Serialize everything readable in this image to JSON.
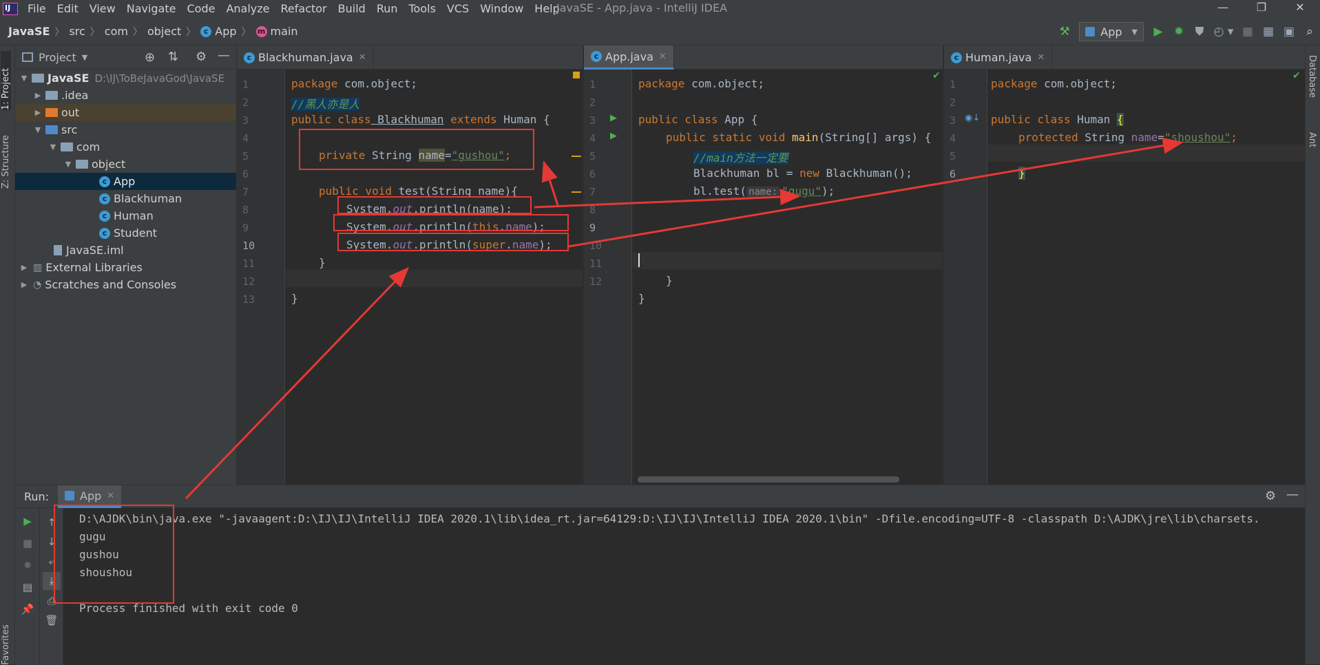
{
  "menubar": {
    "items": [
      "File",
      "Edit",
      "View",
      "Navigate",
      "Code",
      "Analyze",
      "Refactor",
      "Build",
      "Run",
      "Tools",
      "VCS",
      "Window",
      "Help"
    ],
    "title": "JavaSE - App.java - IntelliJ IDEA"
  },
  "navbar": {
    "crumbs": [
      "JavaSE",
      "src",
      "com",
      "object",
      "App",
      "main"
    ],
    "run_config": "App"
  },
  "left_strip": {
    "project_tab": "1: Project",
    "structure_tab": "Z: Structure",
    "favorites_tab": "Favorites"
  },
  "right_strip": {
    "database_tab": "Database",
    "ant_tab": "Ant"
  },
  "project": {
    "header": "Project",
    "tree": [
      {
        "label": "JavaSE",
        "path": "D:\\IJ\\ToBeJavaGod\\JavaSE"
      },
      {
        "label": ".idea"
      },
      {
        "label": "out"
      },
      {
        "label": "src"
      },
      {
        "label": "com"
      },
      {
        "label": "object"
      },
      {
        "label": "App"
      },
      {
        "label": "Blackhuman"
      },
      {
        "label": "Human"
      },
      {
        "label": "Student"
      },
      {
        "label": "JavaSE.iml"
      },
      {
        "label": "External Libraries"
      },
      {
        "label": "Scratches and Consoles"
      }
    ]
  },
  "editors": {
    "blackhuman": {
      "tab": "Blackhuman.java",
      "lines": [
        "1",
        "2",
        "3",
        "4",
        "5",
        "6",
        "7",
        "8",
        "9",
        "10",
        "11",
        "12",
        "13"
      ],
      "code": {
        "l1_kw": "package",
        "l1_rest": " com.object;",
        "l2": "//黑人亦是人",
        "l3_kw1": "public class",
        "l3_cls": " Blackhuman",
        "l3_kw2": " extends",
        "l3_rest": " Human {",
        "l5_kw": "private",
        "l5_type": " String ",
        "l5_name": "name",
        "l5_eq": "=",
        "l5_str": "\"gushou\"",
        "l5_end": ";",
        "l7_kw": "public void",
        "l7_fn": " test",
        "l7_rest": "(String name){",
        "l8_a": "System.",
        "l8_out": "out",
        "l8_b": ".println(name);",
        "l9_a": "System.",
        "l9_out": "out",
        "l9_b": ".println(",
        "l9_kw": "this",
        "l9_c": ".",
        "l9_fld": "name",
        "l9_d": ");",
        "l10_a": "System.",
        "l10_out": "out",
        "l10_b": ".println(",
        "l10_kw": "super",
        "l10_c": ".",
        "l10_fld": "name",
        "l10_d": ");",
        "l11": "}",
        "l13": "}"
      }
    },
    "app": {
      "tab": "App.java",
      "lines": [
        "1",
        "2",
        "3",
        "4",
        "5",
        "6",
        "7",
        "8",
        "9",
        "10",
        "11",
        "12"
      ],
      "code": {
        "l1_kw": "package",
        "l1_rest": " com.object;",
        "l3_kw": "public class",
        "l3_rest": " App {",
        "l4_kw": "public static void",
        "l4_fn": " main",
        "l4_rest": "(String[] args) {",
        "l5": "//main方法一定要",
        "l6_a": "Blackhuman bl = ",
        "l6_kw": "new",
        "l6_b": " Blackhuman();",
        "l7_a": "bl.test(",
        "l7_hint": "name:",
        "l7_str": "\"gugu\"",
        "l7_b": ");",
        "l10": "}",
        "l11": "}"
      }
    },
    "human": {
      "tab": "Human.java",
      "lines": [
        "1",
        "2",
        "3",
        "4",
        "5",
        "6"
      ],
      "code": {
        "l1_kw": "package",
        "l1_rest": " com.object;",
        "l3_kw": "public class",
        "l3_rest": " Human ",
        "l3_brace": "{",
        "l4_kw": "protected",
        "l4_type": " String ",
        "l4_fld": "name",
        "l4_eq": "=",
        "l4_str": "\"shoushou\"",
        "l4_end": ";",
        "l6": "}"
      }
    }
  },
  "run_panel": {
    "label": "Run:",
    "tab": "App",
    "console": [
      "D:\\AJDK\\bin\\java.exe \"-javaagent:D:\\IJ\\IJ\\IntelliJ IDEA 2020.1\\lib\\idea_rt.jar=64129:D:\\IJ\\IJ\\IntelliJ IDEA 2020.1\\bin\" -Dfile.encoding=UTF-8 -classpath D:\\AJDK\\jre\\lib\\charsets.",
      "gugu",
      "gushou",
      "shoushou",
      "",
      "Process finished with exit code 0"
    ]
  },
  "colors": {
    "annotation": "#e53935",
    "accent": "#4a88c7",
    "run_green": "#4caf50"
  }
}
